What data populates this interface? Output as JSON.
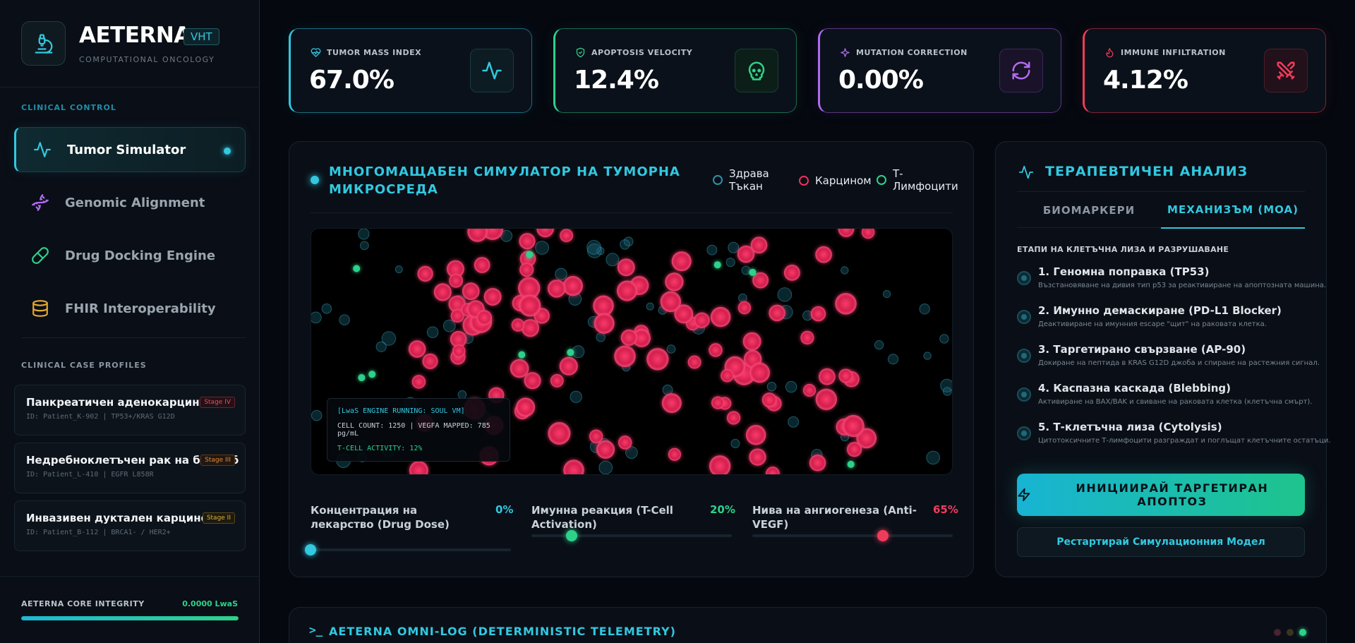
{
  "brand": {
    "name": "AETERNA",
    "badge": "VHT",
    "subtitle": "COMPUTATIONAL ONCOLOGY"
  },
  "sidebar": {
    "section_control": "CLINICAL CONTROL",
    "nav": [
      {
        "label": "Tumor Simulator",
        "icon": "pulse-icon",
        "active": true
      },
      {
        "label": "Genomic Alignment",
        "icon": "dna-icon",
        "active": false
      },
      {
        "label": "Drug Docking Engine",
        "icon": "pill-icon",
        "active": false
      },
      {
        "label": "FHIR Interoperability",
        "icon": "database-icon",
        "active": false
      }
    ],
    "section_cases": "CLINICAL CASE PROFILES",
    "cases": [
      {
        "title": "Панкреатичен аденокарцином",
        "id": "ID: Patient_K-902 | TP53+/KRAS G12D",
        "stage": "Stage IV"
      },
      {
        "title": "Недребноклетъчен рак на б. дроб",
        "id": "ID: Patient_L-410 | EGFR L858R",
        "stage": "Stage III"
      },
      {
        "title": "Инвазивен дуктален карцином",
        "id": "ID: Patient_B-112 | BRCA1- / HER2+",
        "stage": "Stage II"
      }
    ],
    "integrity_label": "AETERNA CORE INTEGRITY",
    "integrity_value": "0.0000 LwaS",
    "integrity_fill": 1.0
  },
  "stats": [
    {
      "label": "TUMOR MASS INDEX",
      "value": "67.0%",
      "label_icon": "heart-pulse-icon",
      "icon": "pulse-icon",
      "color": "#32c8e0"
    },
    {
      "label": "APOPTOSIS VELOCITY",
      "value": "12.4%",
      "label_icon": "shield-check-icon",
      "icon": "skull-icon",
      "color": "#2ed18a"
    },
    {
      "label": "MUTATION CORRECTION",
      "value": "0.00%",
      "label_icon": "sparkle-icon",
      "icon": "refresh-icon",
      "color": "#b06cf0"
    },
    {
      "label": "IMMUNE INFILTRATION",
      "value": "4.12%",
      "label_icon": "flame-icon",
      "icon": "swords-icon",
      "color": "#f03c5c"
    }
  ],
  "simulator": {
    "title": "МНОГОМАЩАБЕН СИМУЛАТОР НА ТУМОРНА МИКРОСРЕДА",
    "legend": [
      {
        "label": "Здрава Тъкан",
        "color": "#2f8fa8"
      },
      {
        "label": "Карцином",
        "color": "#f0305c"
      },
      {
        "label": "Т-Лимфоцити",
        "color": "#2ed18a"
      }
    ],
    "engine": {
      "line1": "[LwaS ENGINE RUNNING: SOUL VM]",
      "line2": "CELL COUNT: 1250 | VEGFA MAPPED: 785 pg/mL",
      "line3": "T-CELL ACTIVITY: 12%"
    },
    "sliders": [
      {
        "label": "Концентрация на лекарство (Drug Dose)",
        "value_text": "0%",
        "value": 0,
        "color": "#32c8e0"
      },
      {
        "label": "Имунна реакция (T-Cell Activation)",
        "value_text": "20%",
        "value": 20,
        "color": "#2ed18a"
      },
      {
        "label": "Нива на ангиогенеза (Anti-VEGF)",
        "value_text": "65%",
        "value": 65,
        "color": "#f03c5c"
      }
    ]
  },
  "analysis": {
    "title": "ТЕРАПЕВТИЧЕН АНАЛИЗ",
    "tabs": [
      {
        "label": "БИОМАРКЕРИ",
        "active": false
      },
      {
        "label": "МЕХАНИЗЪМ (MOA)",
        "active": true
      }
    ],
    "stages_label": "ЕТАПИ НА КЛЕТЪЧНА ЛИЗА И РАЗРУШАВАНЕ",
    "steps": [
      {
        "title": "1. Геномна поправка (TP53)",
        "desc": "Възстановяване на дивия тип p53 за реактивиране на апоптозната машина."
      },
      {
        "title": "2. Имунно демаскиране (PD-L1 Blocker)",
        "desc": "Деактивиране на имунния escape \"щит\" на раковата клетка."
      },
      {
        "title": "3. Таргетирано свързване (AP-90)",
        "desc": "Докиране на пептида в KRAS G12D джоба и спиране на растежния сигнал."
      },
      {
        "title": "4. Каспазна каскада (Blebbing)",
        "desc": "Активиране на BAX/BAK и свиване на раковата клетка (клетъчна смърт)."
      },
      {
        "title": "5. Т-клетъчна лиза (Cytolysis)",
        "desc": "Цитотоксичните Т-лимфоцити разграждат и поглъщат клетъчните остатъци."
      }
    ],
    "apoptosis_button": "ИНИЦИИРАЙ ТАРГЕТИРАН АПОПТОЗ",
    "restart_button": "Рестартирай Симулационния Модел"
  },
  "log": {
    "prompt": ">_",
    "title": "AETERNA OMNI-LOG (DETERMINISTIC TELEMETRY)"
  },
  "colors": {
    "accent": "#32c8e0",
    "green": "#2ed18a",
    "purple": "#b06cf0",
    "red": "#f03c5c",
    "stage_iv": "#e0505c",
    "stage_iii": "#e08a3a",
    "stage_ii": "#d8b43a"
  }
}
